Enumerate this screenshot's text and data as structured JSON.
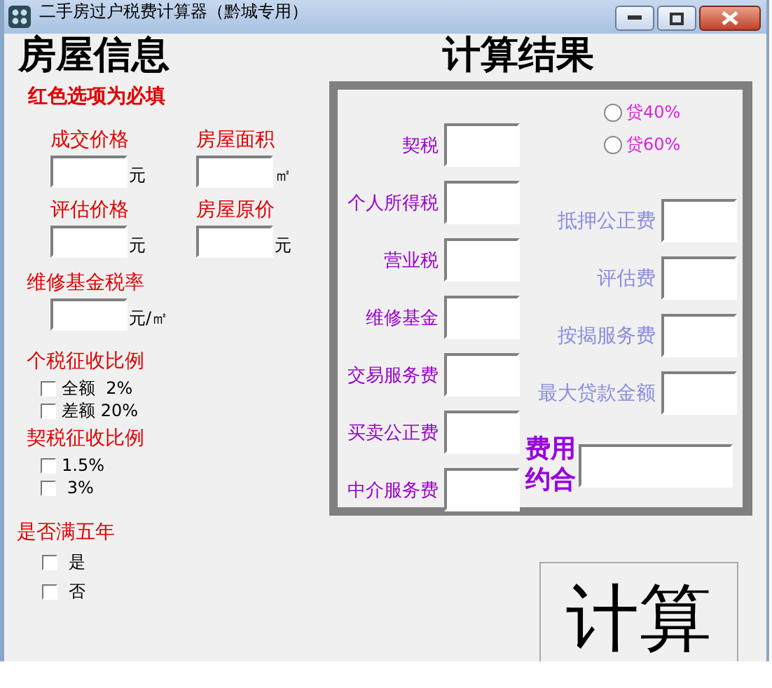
{
  "window": {
    "title": "二手房过户税费计算器（黔城专用）"
  },
  "house": {
    "heading": "房屋信息",
    "note": "红色选项为必填",
    "fields": [
      {
        "label": "成交价格",
        "unit": "元"
      },
      {
        "label": "房屋面积",
        "unit": "㎡"
      },
      {
        "label": "评估价格",
        "unit": "元"
      },
      {
        "label": "房屋原价",
        "unit": "元"
      },
      {
        "label": "维修基金税率",
        "unit": "元/㎡"
      }
    ],
    "groups": [
      {
        "label": "个税征收比例",
        "options": [
          {
            "label": "全额  2%",
            "checked": false
          },
          {
            "label": "差额 20%",
            "checked": false
          }
        ]
      },
      {
        "label": "契税征收比例",
        "options": [
          {
            "label": "1.5%",
            "checked": false
          },
          {
            "label": " 3%",
            "checked": false
          }
        ]
      },
      {
        "label": "是否满五年",
        "options": [
          {
            "label": " 是",
            "checked": false
          },
          {
            "label": " 否",
            "checked": false
          }
        ]
      }
    ]
  },
  "result": {
    "heading": "计算结果",
    "loan_options": [
      {
        "label": "贷40%",
        "selected": false
      },
      {
        "label": "贷60%",
        "selected": false
      }
    ],
    "tax_fields": [
      {
        "label": "契税"
      },
      {
        "label": "个人所得税"
      },
      {
        "label": "营业税"
      },
      {
        "label": "维修基金"
      },
      {
        "label": "交易服务费"
      },
      {
        "label": "买卖公正费"
      },
      {
        "label": "中介服务费"
      }
    ],
    "loan_fields": [
      {
        "label": "抵押公正费"
      },
      {
        "label": "评估费"
      },
      {
        "label": "按揭服务费"
      },
      {
        "label": "最大贷款金额"
      }
    ],
    "total_label": "费用约合"
  },
  "calculate_button": "计算"
}
